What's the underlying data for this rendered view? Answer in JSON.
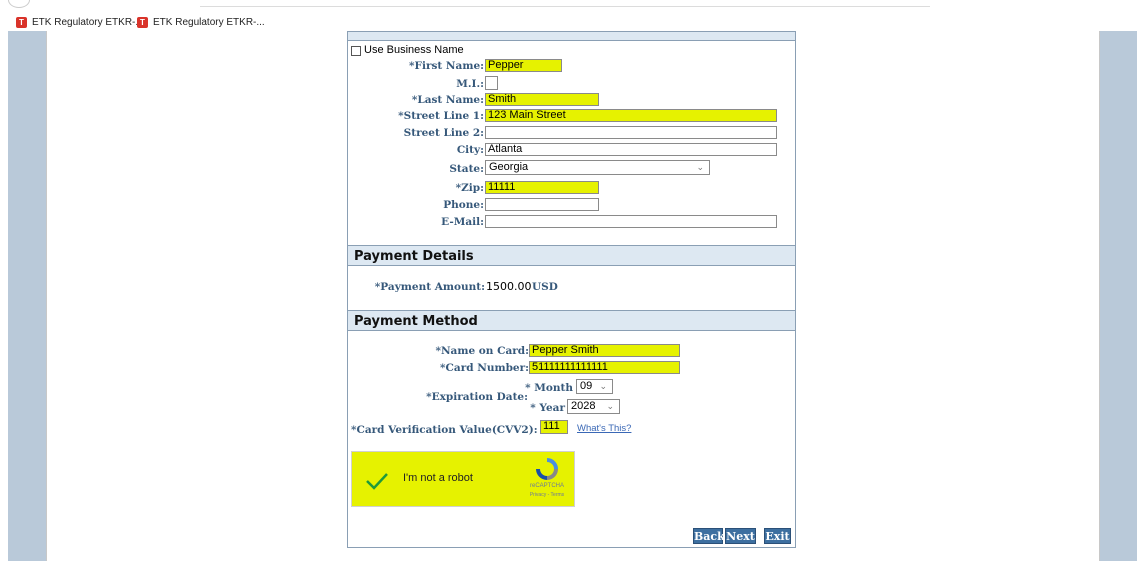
{
  "bookmarks": [
    "ETK Regulatory ETKR-...",
    "ETK Regulatory ETKR-..."
  ],
  "billing": {
    "use_business_name": "Use Business Name",
    "first_name_label": "*First Name:",
    "first_name": "Pepper",
    "mi_label": "M.I.:",
    "mi": "",
    "last_name_label": "*Last Name:",
    "last_name": "Smith",
    "street1_label": "*Street Line 1:",
    "street1": "123 Main Street",
    "street2_label": "Street Line 2:",
    "street2": "",
    "city_label": "City:",
    "city": "Atlanta",
    "state_label": "State:",
    "state": "Georgia",
    "zip_label": "*Zip:",
    "zip": "11111",
    "phone_label": "Phone:",
    "phone": "",
    "email_label": "E-Mail:",
    "email": ""
  },
  "payment_details": {
    "title": "Payment Details",
    "amount_label": "*Payment Amount:",
    "amount_value": "1500.00",
    "currency": "USD"
  },
  "payment_method": {
    "title": "Payment Method",
    "name_on_card_label": "*Name on Card:",
    "name_on_card": "Pepper Smith",
    "card_number_label": "*Card Number:",
    "card_number": "51111111111111",
    "expiration_label": "*Expiration Date:",
    "month_label": "* Month",
    "month": "09",
    "year_label": "* Year",
    "year": "2028",
    "cvv_label": "*Card Verification Value(CVV2):",
    "cvv": "111",
    "whats_this": "What's This?"
  },
  "captcha": {
    "label": "I'm not a robot",
    "brand": "reCAPTCHA",
    "links": "Privacy - Terms"
  },
  "buttons": {
    "back": "Back",
    "next": "Next",
    "exit": "Exit"
  },
  "colors": {
    "highlight": "#e6f200",
    "section_bg": "#dde8f2",
    "label": "#36587a",
    "button": "#3d6fa0",
    "frame": "#b9c9d9"
  }
}
